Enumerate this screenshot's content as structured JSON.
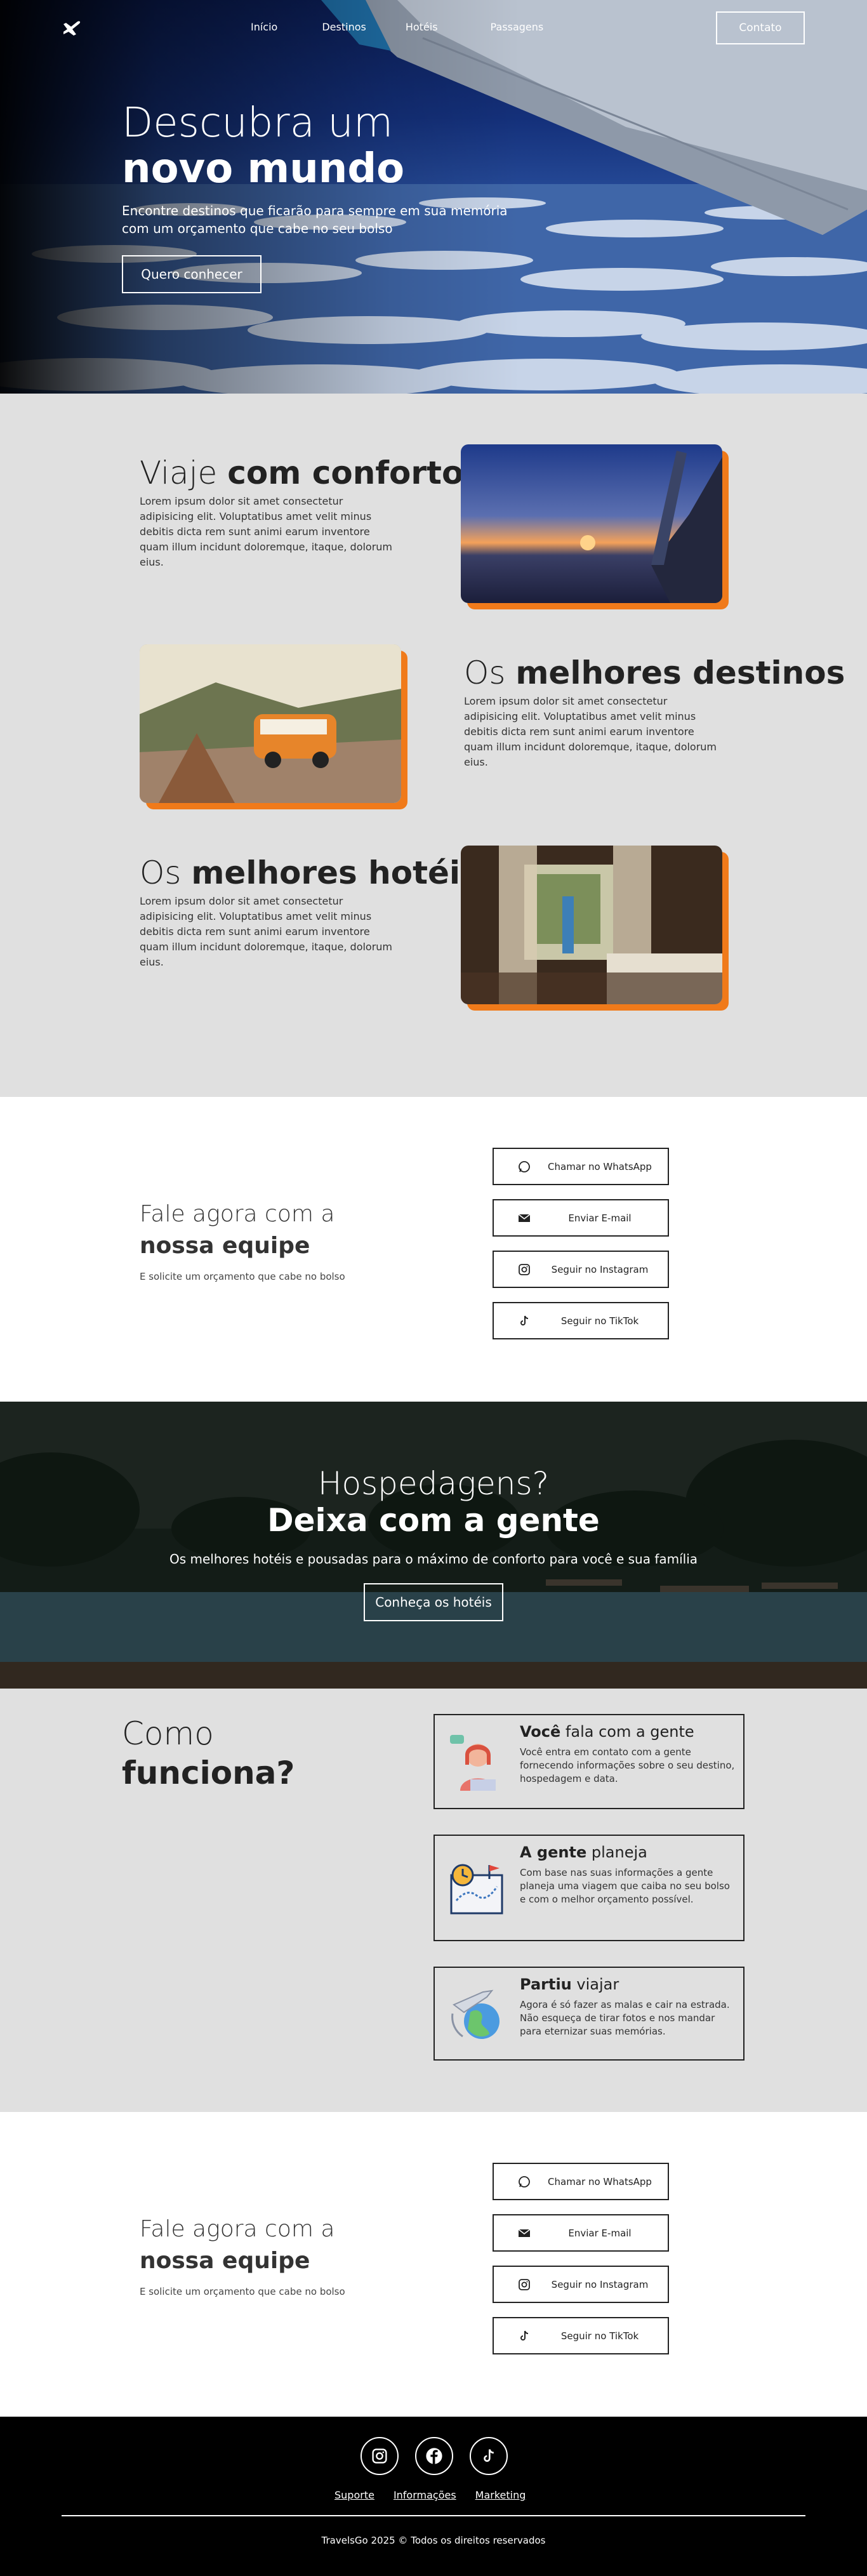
{
  "nav": {
    "links": [
      "Início",
      "Destinos",
      "Hotéis",
      "Passagens"
    ],
    "contact_label": "Contato"
  },
  "hero": {
    "title_light": "Descubra um",
    "title_bold": "novo mundo",
    "subtitle": "Encontre destinos que ficarão para sempre em sua memória com um orçamento que cabe no seu bolso",
    "cta_label": "Quero conhecer"
  },
  "features": [
    {
      "title_light": "Viaje",
      "title_bold": "com conforto",
      "desc": "Lorem ipsum dolor sit amet consectetur adipisicing elit. Voluptatibus amet velit minus debitis dicta rem sunt animi earum inventore quam illum incidunt doloremque, itaque, dolorum eius."
    },
    {
      "title_light": "Os",
      "title_bold": "melhores destinos",
      "desc": "Lorem ipsum dolor sit amet consectetur adipisicing elit. Voluptatibus amet velit minus debitis dicta rem sunt animi earum inventore quam illum incidunt doloremque, itaque, dolorum eius."
    },
    {
      "title_light": "Os",
      "title_bold": "melhores hotéis",
      "desc": "Lorem ipsum dolor sit amet consectetur adipisicing elit. Voluptatibus amet velit minus debitis dicta rem sunt animi earum inventore quam illum incidunt doloremque, itaque, dolorum eius."
    }
  ],
  "contact": {
    "title_light": "Fale agora com a",
    "title_bold": "nossa equipe",
    "subtitle": "E solicite um orçamento que cabe no bolso",
    "buttons": [
      {
        "label": "Chamar no WhatsApp",
        "icon": "whatsapp-icon"
      },
      {
        "label": "Enviar E-mail",
        "icon": "email-icon"
      },
      {
        "label": "Seguir no Instagram",
        "icon": "instagram-icon"
      },
      {
        "label": "Seguir no TikTok",
        "icon": "tiktok-icon"
      }
    ]
  },
  "stay": {
    "title_light": "Hospedagens?",
    "title_bold": "Deixa com a gente",
    "subtitle": "Os melhores hotéis e pousadas para o máximo de conforto para você e sua família",
    "cta_label": "Conheça os hotéis"
  },
  "how": {
    "title_light": "Como",
    "title_bold": "funciona?",
    "steps": [
      {
        "title_bold": "Você",
        "title_light": "fala com a gente",
        "desc": "Você entra em contato com a gente fornecendo informações sobre o seu destino, hospedagem e data."
      },
      {
        "title_bold": "A gente",
        "title_light": "planeja",
        "desc": "Com base nas suas informações a gente planeja uma viagem que caiba no seu bolso e com o melhor orçamento possível."
      },
      {
        "title_bold": "Partiu",
        "title_light": "viajar",
        "desc": "Agora é só fazer as malas e cair na estrada. Não esqueça de tirar fotos e nos mandar para eternizar suas memórias."
      }
    ]
  },
  "footer": {
    "links": [
      "Suporte",
      "Informações",
      "Marketing"
    ],
    "copyright": "TravelsGo 2025 © Todos os direitos reservados"
  },
  "colors": {
    "accent": "#f07a1a",
    "section_bg": "#e0e0e0",
    "footer_bg": "#000000"
  }
}
